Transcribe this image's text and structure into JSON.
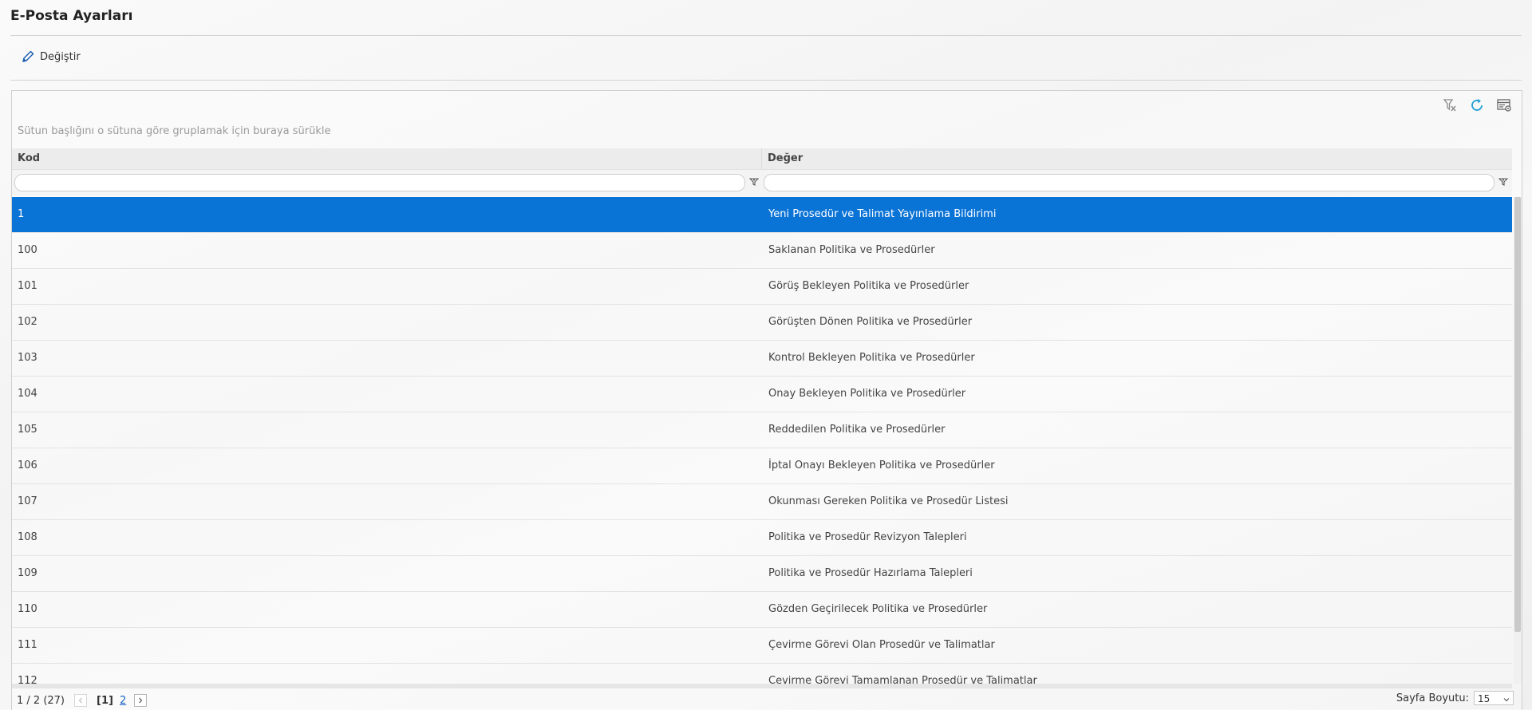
{
  "page": {
    "title": "E-Posta Ayarları"
  },
  "toolbar": {
    "edit_label": "Değiştir",
    "edit_icon": "pencil-icon"
  },
  "grid": {
    "group_hint": "Sütun başlığını o sütuna göre gruplamak için buraya sürükle",
    "tools": [
      "clear-filter-icon",
      "refresh-icon",
      "column-settings-icon"
    ],
    "columns": [
      {
        "label": "Kod"
      },
      {
        "label": "Değer"
      }
    ],
    "filter_values": [
      "",
      ""
    ],
    "selected_index": 0,
    "rows": [
      {
        "kod": "1",
        "deger": "Yeni Prosedür ve Talimat Yayınlama Bildirimi"
      },
      {
        "kod": "100",
        "deger": "Saklanan Politika ve Prosedürler"
      },
      {
        "kod": "101",
        "deger": "Görüş Bekleyen Politika ve Prosedürler"
      },
      {
        "kod": "102",
        "deger": "Görüşten Dönen Politika ve Prosedürler"
      },
      {
        "kod": "103",
        "deger": "Kontrol Bekleyen Politika ve Prosedürler"
      },
      {
        "kod": "104",
        "deger": "Onay Bekleyen Politika ve Prosedürler"
      },
      {
        "kod": "105",
        "deger": "Reddedilen Politika ve Prosedürler"
      },
      {
        "kod": "106",
        "deger": "İptal Onayı Bekleyen Politika ve Prosedürler"
      },
      {
        "kod": "107",
        "deger": "Okunması Gereken Politika ve Prosedür Listesi"
      },
      {
        "kod": "108",
        "deger": "Politika ve Prosedür Revizyon Talepleri"
      },
      {
        "kod": "109",
        "deger": "Politika ve Prosedür Hazırlama Talepleri"
      },
      {
        "kod": "110",
        "deger": "Gözden Geçirilecek Politika ve Prosedürler"
      },
      {
        "kod": "111",
        "deger": "Çevirme Görevi Olan Prosedür ve Talimatlar"
      },
      {
        "kod": "112",
        "deger": "Çevirme Görevi Tamamlanan Prosedür ve Talimatlar"
      }
    ]
  },
  "pager": {
    "info": "1 / 2 (27)",
    "current_page": "[1]",
    "next_page": "2",
    "page_size_label": "Sayfa Boyutu:",
    "page_size": "15"
  },
  "colors": {
    "selected_row": "#0a73d6",
    "link": "#1a62c9",
    "refresh_icon": "#1fa0d8"
  }
}
